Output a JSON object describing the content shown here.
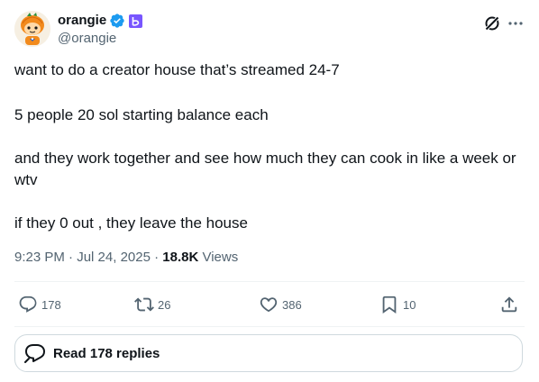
{
  "author": {
    "display_name": "orangie",
    "handle": "@orangie",
    "avatar_icon": "pumpkin-character-avatar",
    "verified_icon": "blue-verified-badge-icon",
    "affiliate_icon": "purple-affiliate-badge-icon"
  },
  "header": {
    "grok_icon": "grok-icon",
    "more_icon": "more-horizontal-icon"
  },
  "tweet": {
    "paragraphs": [
      "want to do a creator house that’s streamed 24-7",
      "5 people 20 sol starting balance each",
      "and they work together and see how much they can cook in like a week or wtv",
      "if they 0 out , they leave the house"
    ],
    "time": "9:23 PM",
    "separator": " · ",
    "date": "Jul 24, 2025",
    "views_count": "18.8K",
    "views_label": " Views"
  },
  "actions": {
    "replies": "178",
    "reposts": "26",
    "likes": "386",
    "bookmarks": "10"
  },
  "read_replies": {
    "label": "Read 178 replies"
  },
  "colors": {
    "text": "#0f1419",
    "secondary": "#536471",
    "verified": "#1d9bf0",
    "affiliate": "#7856ff",
    "border": "#cfd9de"
  }
}
